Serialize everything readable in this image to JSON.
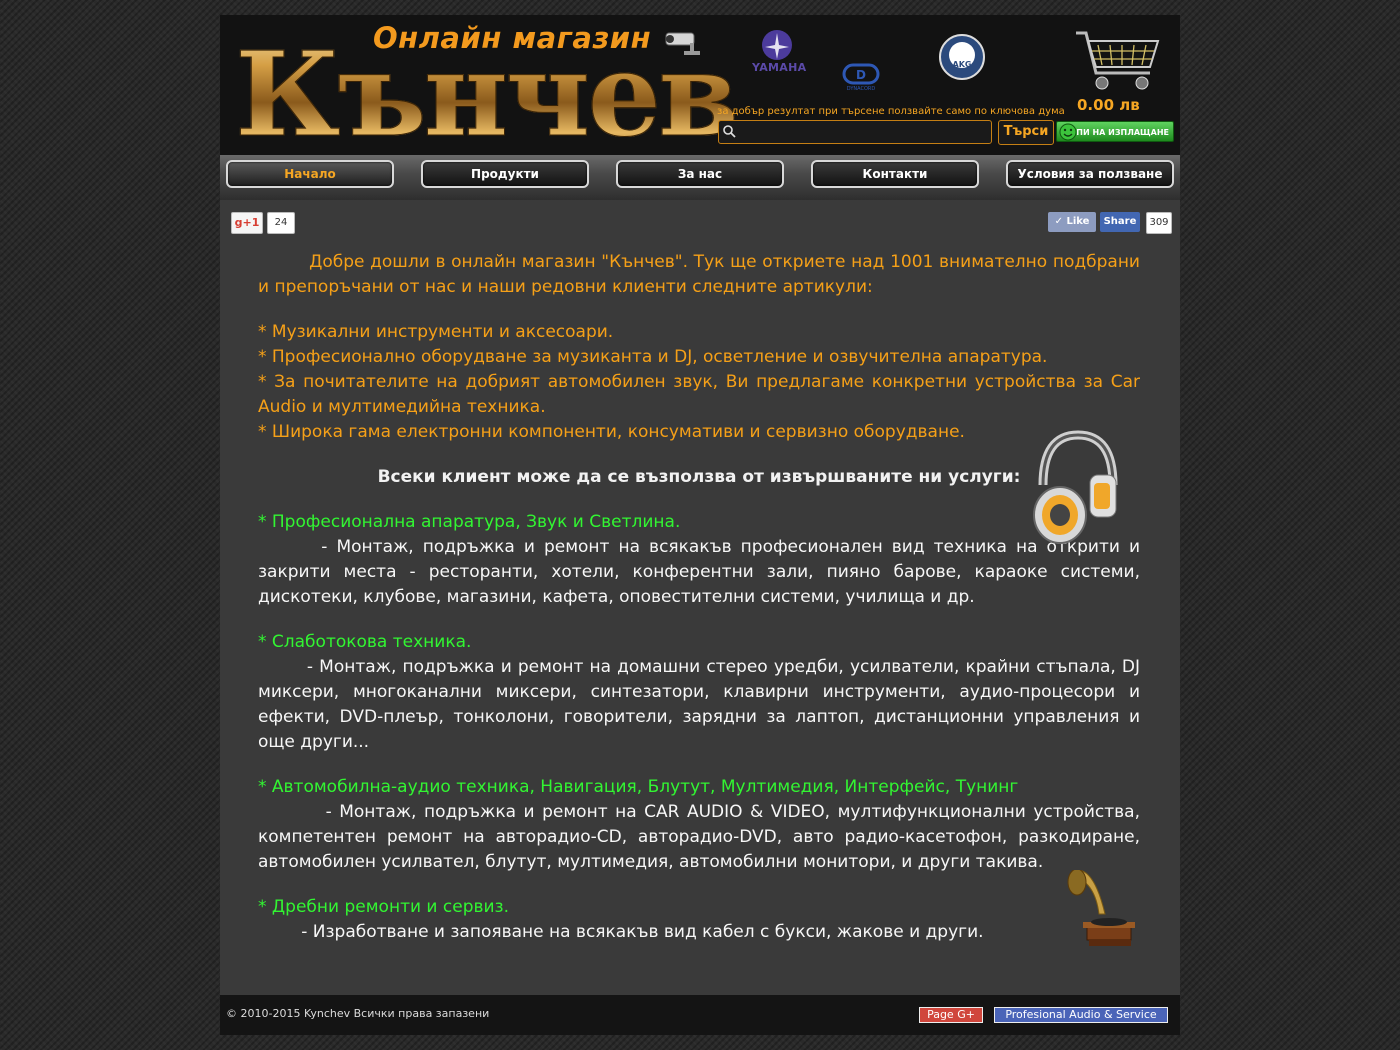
{
  "header": {
    "logo_sub": "Онлайн магазин",
    "logo_main": "Кънчев",
    "brands": [
      "YAMAHA",
      "DYNACORD",
      "AKG"
    ],
    "cart_total": "0.00 лв",
    "search_hint": "за добър резултат при търсене ползвайте само по ключова дума",
    "search_value": "",
    "search_button": "Търси",
    "pay_button": "КУПИ НА ИЗПЛАЩАНЕ"
  },
  "nav": {
    "items": [
      {
        "label": "Начало",
        "active": true
      },
      {
        "label": "Продукти"
      },
      {
        "label": "За нас"
      },
      {
        "label": "Контакти"
      },
      {
        "label": "Условия за ползване"
      }
    ]
  },
  "social": {
    "gplus_label": "+1",
    "gplus_count": "24",
    "fb_like": "Like",
    "fb_share": "Share",
    "fb_count": "309"
  },
  "content": {
    "intro": "         Добре дошли в онлайн магазин \"Кънчев\". Тук ще откриете над 1001 внимателно подбрани и препоръчани от нас и наши редовни клиенти следните артикули:",
    "bullets": [
      " * Музикални инструменти и аксесоари.",
      " * Професионално оборудване за музиканта и DJ, осветление и озвучителна апаратура.",
      " * За почитателите на добрият автомобилен звук, Ви предлагаме конкретни устройства за Car Audio и мултимедийна  техника.",
      " * Широка гама електронни компоненти, консумативи и сервизно оборудване."
    ],
    "services_heading": "Всеки клиент може да се възползва от извършваните ни услуги:",
    "services": [
      {
        "title": " * Професионална апаратура, Звук и Светлина.",
        "text": "       - Монтаж, подръжка и ремонт на всякакъв професионален вид техника на открити и закрити места - ресторанти, хотели, конферентни зали, пияно барове, караоке системи, дискотеки, клубове, магазини, кафета, оповестителни системи, училища и др."
      },
      {
        "title": " * Слаботокова техника.",
        "text": "        - Монтаж, подръжка и ремонт на домашни стерео уредби, усилватели, крайни стъпала, DJ миксери, многоканални миксери, синтезатори, клавирни инструменти, аудио-процесори и ефекти, DVD-плеър, тонколони, говорители, зарядни за лаптоп, дистанционни управления и още други..."
      },
      {
        "title": " * Автомобилна-аудио техника, Навигация, Блутут, Мултимедия, Интерфейс, Тунинг",
        "text": "         - Монтаж, подръжка и ремонт на CAR AUDIO & VIDEO, мултифункционални устройства, компетентен ремонт на авторадио-CD, авторадио-DVD, авто радио-касетофон, разкодиране, автомобилен усилвател, блутут, мултимедия, автомобилни монитори, и други такива."
      },
      {
        "title": " * Дребни ремонти и сервиз.",
        "text": "        - Изработване и запояване на всякакъв вид кабел с букси, жакове и други."
      }
    ]
  },
  "footer": {
    "copyright": "© 2010-2015 Kynchev  Всички права запазени",
    "page_gplus": "Page G+",
    "pro_audio": "Profesional Audio & Service"
  },
  "colors": {
    "accent_orange": "#f5a018",
    "service_green": "#32f532",
    "body_bg": "#2a2a2a",
    "content_bg": "#3a3a3a"
  }
}
